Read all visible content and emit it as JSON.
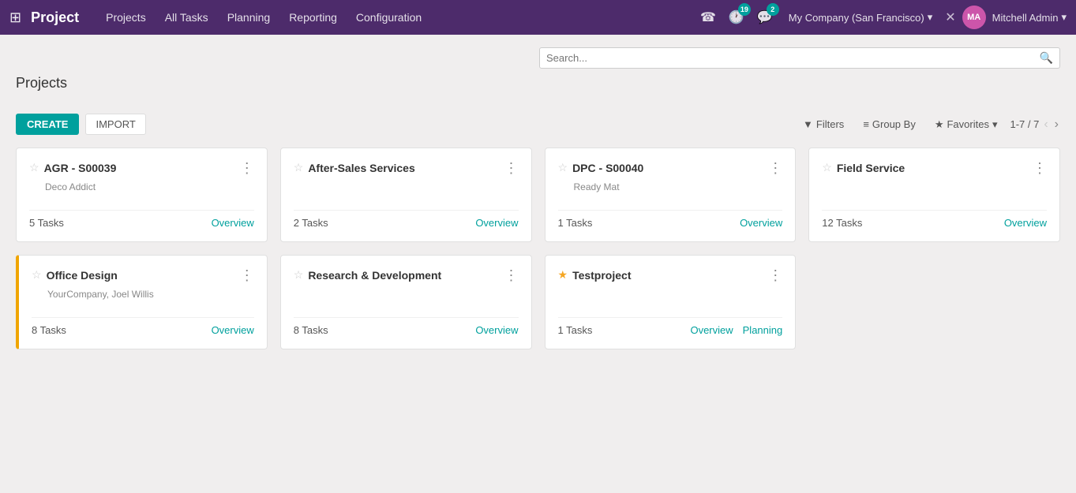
{
  "navbar": {
    "brand": "Project",
    "nav_items": [
      {
        "label": "Projects",
        "active": true
      },
      {
        "label": "All Tasks",
        "active": false
      },
      {
        "label": "Planning",
        "active": false
      },
      {
        "label": "Reporting",
        "active": false
      },
      {
        "label": "Configuration",
        "active": false
      }
    ],
    "badge_activity": "19",
    "badge_messages": "2",
    "company": "My Company (San Francisco)",
    "user": "Mitchell Admin"
  },
  "page": {
    "title": "Projects",
    "create_label": "CREATE",
    "import_label": "IMPORT",
    "search_placeholder": "Search...",
    "filters_label": "Filters",
    "groupby_label": "Group By",
    "favorites_label": "Favorites",
    "pagination": "1-7 / 7"
  },
  "projects": [
    {
      "id": "agr-s00039",
      "title": "AGR - S00039",
      "subtitle": "Deco Addict",
      "starred": false,
      "tasks_count": "5 Tasks",
      "links": [
        "Overview"
      ],
      "has_left_border": false
    },
    {
      "id": "after-sales-services",
      "title": "After-Sales Services",
      "subtitle": "",
      "starred": false,
      "tasks_count": "2 Tasks",
      "links": [
        "Overview"
      ],
      "has_left_border": false
    },
    {
      "id": "dpc-s00040",
      "title": "DPC - S00040",
      "subtitle": "Ready Mat",
      "starred": false,
      "tasks_count": "1 Tasks",
      "links": [
        "Overview"
      ],
      "has_left_border": false
    },
    {
      "id": "field-service",
      "title": "Field Service",
      "subtitle": "",
      "starred": false,
      "tasks_count": "12 Tasks",
      "links": [
        "Overview"
      ],
      "has_left_border": false
    },
    {
      "id": "office-design",
      "title": "Office Design",
      "subtitle": "YourCompany, Joel Willis",
      "starred": false,
      "tasks_count": "8 Tasks",
      "links": [
        "Overview"
      ],
      "has_left_border": true
    },
    {
      "id": "research-development",
      "title": "Research & Development",
      "subtitle": "",
      "starred": false,
      "tasks_count": "8 Tasks",
      "links": [
        "Overview"
      ],
      "has_left_border": false
    },
    {
      "id": "testproject",
      "title": "Testproject",
      "subtitle": "",
      "starred": true,
      "tasks_count": "1 Tasks",
      "links": [
        "Overview",
        "Planning"
      ],
      "has_left_border": false
    }
  ]
}
